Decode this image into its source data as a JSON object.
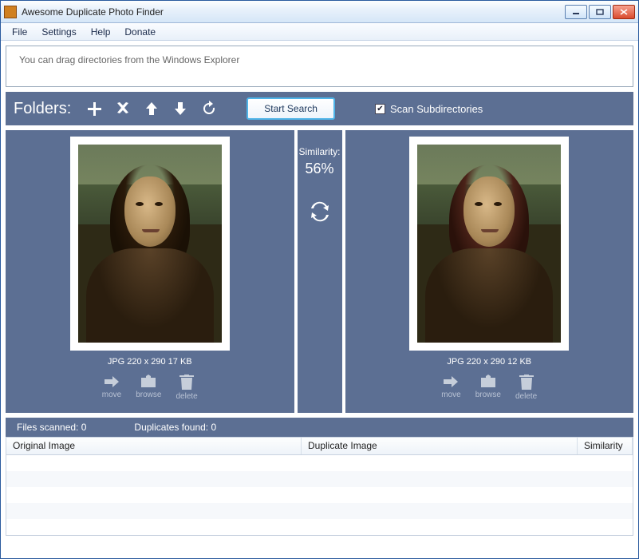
{
  "window": {
    "title": "Awesome Duplicate Photo Finder"
  },
  "menu": {
    "file": "File",
    "settings": "Settings",
    "help": "Help",
    "donate": "Donate"
  },
  "dropzone": {
    "hint": "You can drag directories from the Windows Explorer"
  },
  "toolbar": {
    "folders_label": "Folders:",
    "start_search": "Start Search",
    "scan_subdirs": "Scan Subdirectories",
    "scan_subdirs_checked": true
  },
  "similarity": {
    "label": "Similarity:",
    "value": "56%"
  },
  "left": {
    "info": "JPG  220 x 290   17 KB",
    "actions": {
      "move": "move",
      "browse": "browse",
      "delete": "delete"
    }
  },
  "right": {
    "info": "JPG  220 x 290   12 KB",
    "actions": {
      "move": "move",
      "browse": "browse",
      "delete": "delete"
    }
  },
  "status": {
    "files_scanned_label": "Files scanned:",
    "files_scanned": "0",
    "duplicates_found_label": "Duplicates found:",
    "duplicates_found": "0"
  },
  "results": {
    "col_original": "Original Image",
    "col_duplicate": "Duplicate Image",
    "col_similarity": "Similarity"
  }
}
